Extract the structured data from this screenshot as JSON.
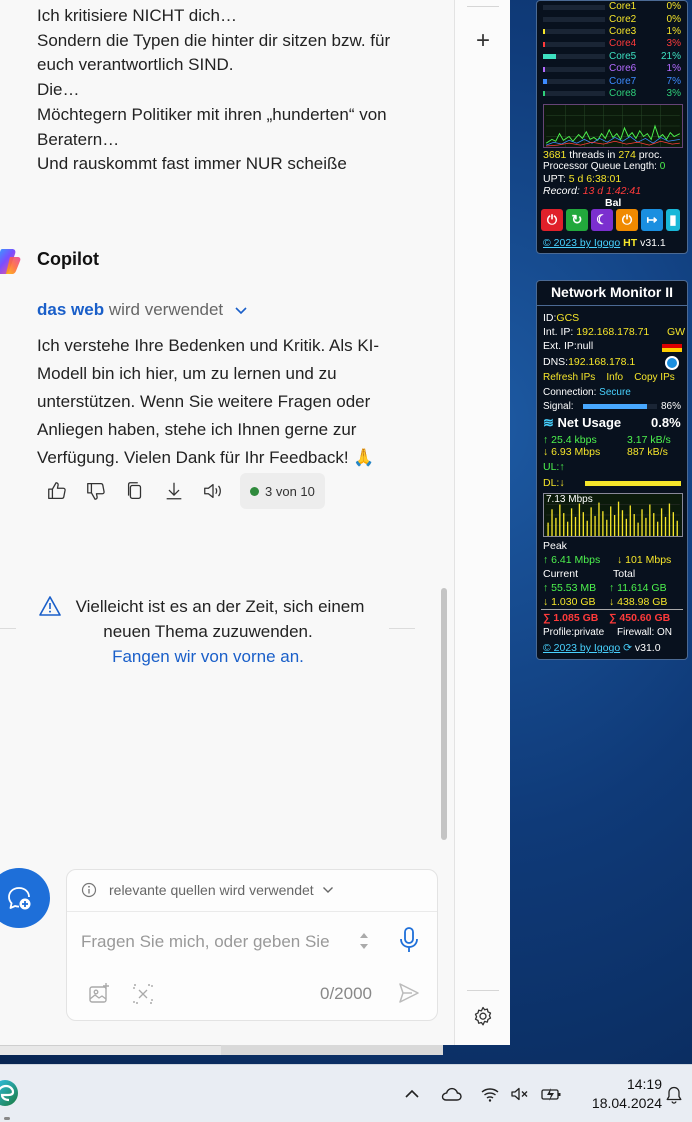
{
  "conversation": {
    "user_lines": [
      "Ich kritisiere NICHT dich…",
      "Sondern die Typen die hinter dir sitzen bzw. für",
      "euch verantwortlich SIND.",
      "Die…",
      "Möchtegern Politiker mit ihren „hunderten“ von",
      "Beratern…",
      "Und rauskommt fast immer NUR scheiße"
    ],
    "assistant_name": "Copilot",
    "web_strong": "das web",
    "web_muted": "wird verwendet",
    "answer": "Ich verstehe Ihre Bedenken und Kritik. Als KI-Modell bin ich hier, um zu lernen und zu unterstützen. Wenn Sie weitere Fragen oder Anliegen haben, stehe ich Ihnen gerne zur Verfügung. Vielen Dank für Ihr Feedback! 🙏",
    "counter": "3 von 10"
  },
  "notice": {
    "line1": "Vielleicht ist es an der Zeit, sich einem",
    "line2": "neuen Thema zuzuwenden.",
    "link": "Fangen wir von vorne an."
  },
  "composer": {
    "hint": "relevante quellen wird verwendet",
    "placeholder": "Fragen Sie mich, oder geben Sie",
    "char_count": "0/2000"
  },
  "cpu_gadget": {
    "cores": [
      {
        "name": "Core1",
        "value": "0%",
        "fill": 0.0,
        "color": "#f5e52a"
      },
      {
        "name": "Core2",
        "value": "0%",
        "fill": 0.0,
        "color": "#f5e52a"
      },
      {
        "name": "Core3",
        "value": "1%",
        "fill": 0.01,
        "color": "#f5e52a"
      },
      {
        "name": "Core4",
        "value": "3%",
        "fill": 0.03,
        "color": "#ff3a3a"
      },
      {
        "name": "Core5",
        "value": "21%",
        "fill": 0.21,
        "color": "#3de0c0"
      },
      {
        "name": "Core6",
        "value": "1%",
        "fill": 0.01,
        "color": "#b36bff"
      },
      {
        "name": "Core7",
        "value": "7%",
        "fill": 0.07,
        "color": "#3d8bff"
      },
      {
        "name": "Core8",
        "value": "3%",
        "fill": 0.03,
        "color": "#2fd07a"
      }
    ],
    "threads_count": "3681",
    "threads_label": "threads in",
    "proc_count": "274",
    "proc_label": "proc.",
    "queue_label": "Processor Queue Length:",
    "queue_value": "0",
    "upt_label": "UPT:",
    "upt_value": "5 d 6:38:01",
    "record_label": "Record:",
    "record_value": "13 d 1:42:41",
    "mode": "Bal",
    "footer": "© 2023 by Igogo",
    "ht": "HT",
    "version": "v31.1"
  },
  "net_gadget": {
    "title": "Network Monitor II",
    "id_label": "ID:",
    "id_value": "GCS",
    "int_ip_label": "Int. IP:",
    "int_ip": "192.168.178.71",
    "gw": "GW",
    "ext_ip_label": "Ext. IP:",
    "ext_ip": "null",
    "dns_label": "DNS:",
    "dns": "192.168.178.1",
    "refresh": "Refresh IPs",
    "info": "Info",
    "copy": "Copy IPs",
    "conn_label": "Connection:",
    "conn_value": "Secure",
    "signal_label": "Signal:",
    "signal_value": "86%",
    "signal_fill": 0.86,
    "net_usage_label": "Net Usage",
    "net_usage_value": "0.8%",
    "up_kbps": "25.4 kbps",
    "up_kBs": "3.17 kB/s",
    "down_mbps": "6.93 Mbps",
    "down_kBs": "887 kB/s",
    "ul": "UL:",
    "dl": "DL:",
    "graph_label": "7.13 Mbps",
    "peak_label": "Peak",
    "peak_up": "6.41 Mbps",
    "peak_down": "101 Mbps",
    "current_label": "Current",
    "total_label": "Total",
    "cur_up": "55.53 MB",
    "tot_up": "11.614 GB",
    "cur_down": "1.030 GB",
    "tot_down": "438.98 GB",
    "sum_cur": "1.085 GB",
    "sum_tot": "450.60 GB",
    "profile_label": "Profile:",
    "profile_value": "private",
    "firewall_label": "Firewall:",
    "firewall_value": "ON",
    "footer": "© 2023 by Igogo",
    "version": "v31.0"
  },
  "taskbar": {
    "time": "14:19",
    "date": "18.04.2024"
  }
}
